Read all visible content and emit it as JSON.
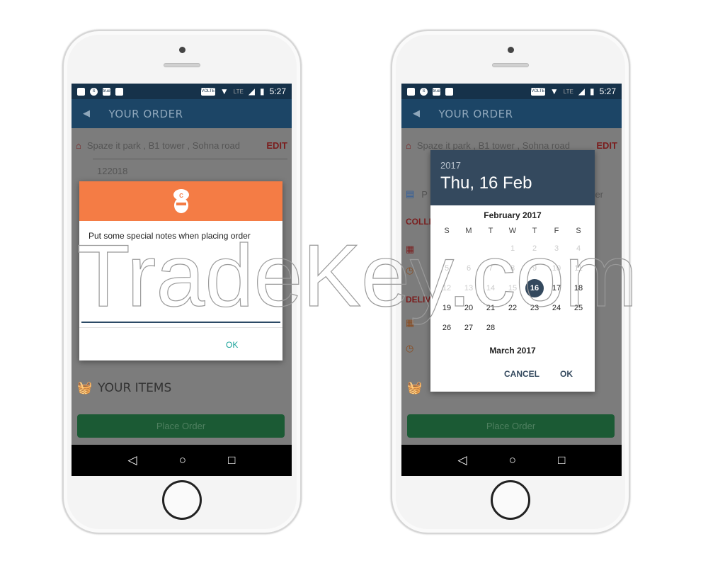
{
  "status": {
    "time": "5:27",
    "volte": "VOLTE",
    "lte": "LTE",
    "true_label": "true"
  },
  "appbar": {
    "title": "YOUR ORDER"
  },
  "address": {
    "line1": "Spaze it park , B1 tower , Sohna road",
    "pincode": "122018",
    "edit": "EDIT"
  },
  "sections": {
    "collect": "COLLE",
    "deliver": "DELIV",
    "items": "YOUR ITEMS",
    "notes_partial": "P",
    "notes_tail": "er"
  },
  "place_order": "Place Order",
  "notes_dialog": {
    "text": "Put some special notes  when placing order",
    "ok": "OK"
  },
  "date_dialog": {
    "year": "2017",
    "date": "Thu, 16 Feb",
    "month": "February 2017",
    "next_month": "March 2017",
    "weekdays": [
      "S",
      "M",
      "T",
      "W",
      "T",
      "F",
      "S"
    ],
    "weeks": [
      [
        "",
        "",
        "",
        "1",
        "2",
        "3",
        "4"
      ],
      [
        "5",
        "6",
        "7",
        "8",
        "9",
        "10",
        "11"
      ],
      [
        "12",
        "13",
        "14",
        "15",
        "16",
        "17",
        "18"
      ],
      [
        "19",
        "20",
        "21",
        "22",
        "23",
        "24",
        "25"
      ],
      [
        "26",
        "27",
        "28",
        "",
        "",
        "",
        ""
      ]
    ],
    "selected": "16",
    "cancel": "CANCEL",
    "ok": "OK"
  },
  "watermark": "TradeKey.com",
  "colors": {
    "appbar": "#1c4566",
    "orange": "#f47c45",
    "picker_header": "#34495e",
    "place_order": "#1b5a34",
    "accent_ok": "#1aa39a"
  }
}
